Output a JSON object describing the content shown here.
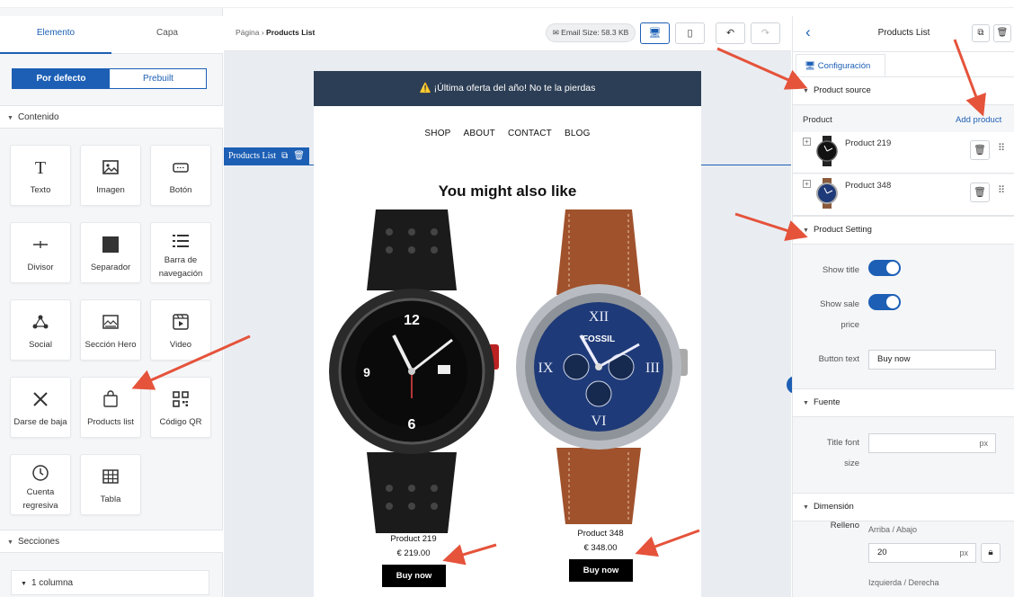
{
  "left_panel": {
    "tabs": [
      "Elemento",
      "Capa"
    ],
    "toggle": [
      "Por defecto",
      "Prebuilt"
    ],
    "content_title": "Contenido",
    "blocks": [
      {
        "label": "Texto",
        "icon": "text-icon"
      },
      {
        "label": "Imagen",
        "icon": "image-icon"
      },
      {
        "label": "Botón",
        "icon": "button-icon"
      },
      {
        "label": "Divisor",
        "icon": "divider-icon"
      },
      {
        "label": "Separador",
        "icon": "spacer-icon"
      },
      {
        "label": "Barra de navegación",
        "icon": "nav-bar-icon"
      },
      {
        "label": "Social",
        "icon": "social-icon"
      },
      {
        "label": "Sección Hero",
        "icon": "hero-icon"
      },
      {
        "label": "Video",
        "icon": "video-icon"
      },
      {
        "label": "Darse de baja",
        "icon": "unsubscribe-icon"
      },
      {
        "label": "Products list",
        "icon": "shopping-bag-icon"
      },
      {
        "label": "Código QR",
        "icon": "qr-code-icon"
      },
      {
        "label": "Cuenta regresiva",
        "icon": "clock-icon"
      },
      {
        "label": "Tabla",
        "icon": "table-icon"
      }
    ],
    "sections_title": "Secciones",
    "column_option": "1 columna"
  },
  "toolbar": {
    "breadcrumb_root": "Página",
    "breadcrumb_current": "Products List",
    "email_size": "Email Size: 58.3 KB"
  },
  "email": {
    "promo": "⚠️ ¡Última oferta del año! No te la pierdas",
    "nav": [
      "SHOP",
      "ABOUT",
      "CONTACT",
      "BLOG"
    ],
    "block_tag": "Products List",
    "heading": "You might also like",
    "products": [
      {
        "name": "Product 219",
        "price": "€ 219.00",
        "button": "Buy now"
      },
      {
        "name": "Product 348",
        "price": "€ 348.00",
        "button": "Buy now"
      }
    ]
  },
  "right_panel": {
    "title": "Products List",
    "config_tab": "Configuración",
    "product_source": {
      "title": "Product source",
      "label": "Product",
      "add": "Add product",
      "items": [
        "Product 219",
        "Product 348"
      ]
    },
    "product_setting": {
      "title": "Product Setting",
      "show_title": "Show title",
      "show_sale_price_1": "Show sale",
      "show_sale_price_2": "price",
      "button_text_label": "Button text",
      "button_text_value": "Buy now",
      "show_title_on": true,
      "show_sale_price_on": true
    },
    "font": {
      "title": "Fuente",
      "title_size_1": "Title font",
      "title_size_2": "size",
      "unit": "px"
    },
    "dimension": {
      "title": "Dimensión",
      "padding": "Relleno",
      "top_bottom": "Arriba / Abajo",
      "top_bottom_value": "20",
      "unit": "px",
      "left_right": "Izquierda / Derecha"
    }
  },
  "colors": {
    "accent": "#1c5fb5",
    "annotation": "#e5533b",
    "promo_bg": "#2c3e55"
  }
}
